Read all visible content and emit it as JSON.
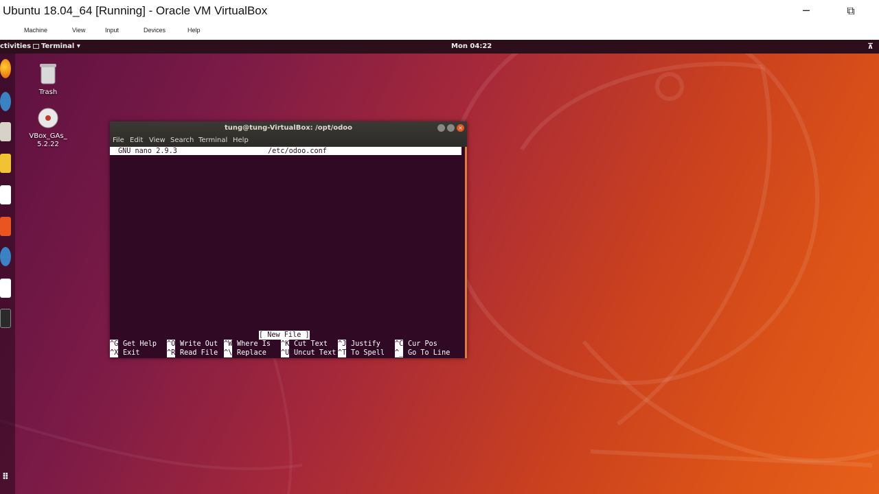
{
  "vbox": {
    "title": "Ubuntu 18.04_64 [Running] - Oracle VM VirtualBox",
    "minimize_icon": "─",
    "restore_icon": "⧉",
    "menu": [
      "Machine",
      "View",
      "Input",
      "Devices",
      "Help"
    ]
  },
  "topbar": {
    "activities": "ctivities",
    "app_menu": "Terminal ▾",
    "clock": "Mon 04:22",
    "network_icon": "⊼"
  },
  "desktop": {
    "trash_label": "Trash",
    "disc_label_line1": "VBox_GAs_",
    "disc_label_line2": "5.2.22"
  },
  "terminal": {
    "title": "tung@tung-VirtualBox: /opt/odoo",
    "menu": [
      "File",
      "Edit",
      "View",
      "Search",
      "Terminal",
      "Help"
    ],
    "nano_version": "GNU nano 2.9.3",
    "filename": "/etc/odoo.conf",
    "status": "[ New File ]",
    "shortcuts_row1": [
      {
        "key": "^G",
        "label": "Get Help"
      },
      {
        "key": "^O",
        "label": "Write Out"
      },
      {
        "key": "^W",
        "label": "Where Is"
      },
      {
        "key": "^K",
        "label": "Cut Text"
      },
      {
        "key": "^J",
        "label": "Justify"
      },
      {
        "key": "^C",
        "label": "Cur Pos"
      }
    ],
    "shortcuts_row2": [
      {
        "key": "^X",
        "label": "Exit"
      },
      {
        "key": "^R",
        "label": "Read File"
      },
      {
        "key": "^\\",
        "label": "Replace"
      },
      {
        "key": "^U",
        "label": "Uncut Text"
      },
      {
        "key": "^T",
        "label": "To Spell"
      },
      {
        "key": "^_",
        "label": "Go To Line"
      }
    ]
  },
  "colors": {
    "terminal_bg": "#300a24",
    "topbar_bg": "#2c0f1a",
    "wallpaper_accent": "#e6601a"
  }
}
